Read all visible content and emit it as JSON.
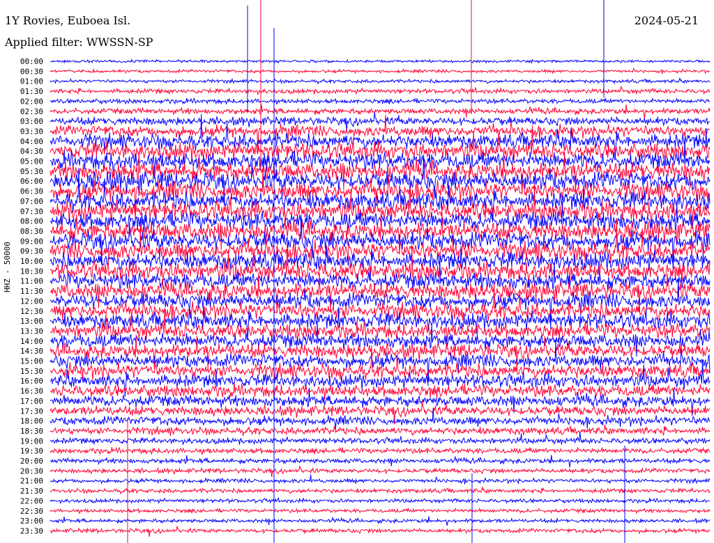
{
  "header": {
    "station": "1Y Rovies, Euboea Isl.",
    "filter": "Applied filter: WWSSN-SP",
    "date": "2024-05-21"
  },
  "chart_data": {
    "type": "line",
    "title": "1Y Rovies, Euboea Isl.",
    "subtitle": "Applied filter: WWSSN-SP",
    "date": "2024-05-21",
    "ylabel": "HHZ - 50000",
    "trace_colors": [
      "#0000ff",
      "#ff0033"
    ],
    "y_tick_labels": [
      "00:00",
      "00:30",
      "01:00",
      "01:30",
      "02:00",
      "02:30",
      "03:00",
      "03:30",
      "04:00",
      "04:30",
      "05:00",
      "05:30",
      "06:00",
      "06:30",
      "07:00",
      "07:30",
      "08:00",
      "08:30",
      "09:00",
      "09:30",
      "10:00",
      "10:30",
      "11:00",
      "11:30",
      "12:00",
      "12:30",
      "13:00",
      "13:30",
      "14:00",
      "14:30",
      "15:00",
      "15:30",
      "16:00",
      "16:30",
      "17:00",
      "17:30",
      "18:00",
      "18:30",
      "19:00",
      "19:30",
      "20:00",
      "20:30",
      "21:00",
      "21:30",
      "22:00",
      "22:30",
      "23:00",
      "23:30"
    ],
    "row_noise_level": [
      0.1,
      0.15,
      0.2,
      0.35,
      0.35,
      0.5,
      0.8,
      1.2,
      1.6,
      1.8,
      1.9,
      2.0,
      2.0,
      2.0,
      2.0,
      2.0,
      2.0,
      2.0,
      2.0,
      2.0,
      1.9,
      1.9,
      1.8,
      1.8,
      1.7,
      1.7,
      1.7,
      1.6,
      1.6,
      1.5,
      1.5,
      1.5,
      1.4,
      1.3,
      1.2,
      1.0,
      0.9,
      0.7,
      0.5,
      0.45,
      0.4,
      0.35,
      0.3,
      0.3,
      0.25,
      0.25,
      0.25,
      0.3
    ]
  }
}
